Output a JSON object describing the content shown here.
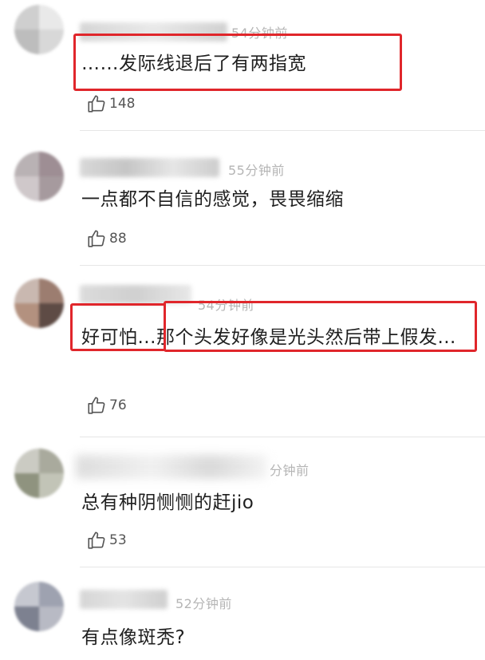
{
  "comments": [
    {
      "time": "54分钟前",
      "text": "……发际线退后了有两指宽",
      "likes": "148"
    },
    {
      "time": "55分钟前",
      "text": "一点都不自信的感觉，畏畏缩缩",
      "likes": "88"
    },
    {
      "time": "54分钟前",
      "text_highlight": "好可怕...",
      "text_rest": "那个头发好像是光头然后带上假发...",
      "likes": "76"
    },
    {
      "time": "分钟前",
      "text": "总有种阴恻恻的赶jio",
      "likes": "53"
    },
    {
      "time": "52分钟前",
      "text": "有点像斑秃?"
    }
  ],
  "colors": {
    "highlight_box": "#e0262b",
    "time_text": "#b5b5b5",
    "divider": "#e6e6e6"
  },
  "icons": {
    "like": "thumbs-up-icon"
  }
}
